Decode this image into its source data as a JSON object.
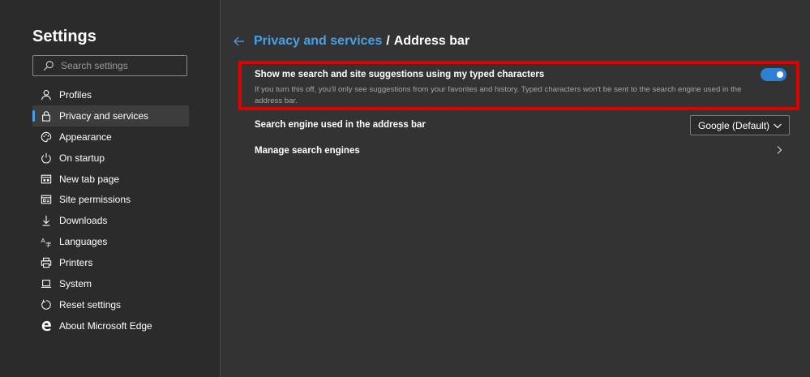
{
  "sidebar": {
    "title": "Settings",
    "search_placeholder": "Search settings",
    "items": [
      {
        "label": "Profiles",
        "icon": "person-icon"
      },
      {
        "label": "Privacy and services",
        "icon": "lock-icon",
        "selected": true
      },
      {
        "label": "Appearance",
        "icon": "palette-icon"
      },
      {
        "label": "On startup",
        "icon": "power-icon"
      },
      {
        "label": "New tab page",
        "icon": "new-tab-icon"
      },
      {
        "label": "Site permissions",
        "icon": "site-permissions-icon"
      },
      {
        "label": "Downloads",
        "icon": "download-icon"
      },
      {
        "label": "Languages",
        "icon": "languages-icon"
      },
      {
        "label": "Printers",
        "icon": "printer-icon"
      },
      {
        "label": "System",
        "icon": "laptop-icon"
      },
      {
        "label": "Reset settings",
        "icon": "reset-icon"
      },
      {
        "label": "About Microsoft Edge",
        "icon": "edge-logo-icon"
      }
    ]
  },
  "main": {
    "breadcrumb": {
      "parent": "Privacy and services",
      "separator": "/",
      "current": "Address bar"
    },
    "suggestions_setting": {
      "title": "Show me search and site suggestions using my typed characters",
      "description": "If you turn this off, you'll only see suggestions from your favorites and history. Typed characters won't be sent to the search engine used in the address bar.",
      "enabled": true
    },
    "search_engine_row": {
      "label": "Search engine used in the address bar",
      "selected_value": "Google (Default)"
    },
    "manage_row": {
      "label": "Manage search engines"
    }
  },
  "colors": {
    "accent": "#4aa0e6",
    "toggle_on": "#2f7fd3",
    "highlight": "#e00000",
    "background": "#333333",
    "sidebar_background": "#2b2b2b"
  }
}
